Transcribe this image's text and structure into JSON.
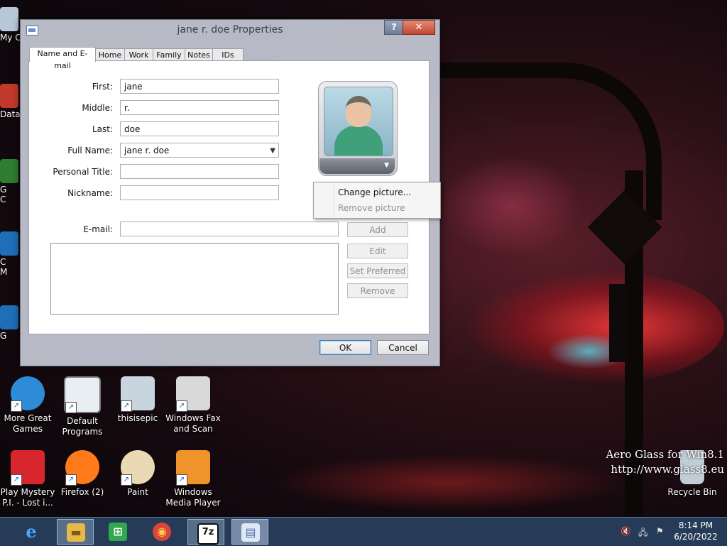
{
  "dialog": {
    "title": "jane r. doe Properties",
    "help_label": "?",
    "close_label": "✕",
    "tabs": [
      "Name and E-mail",
      "Home",
      "Work",
      "Family",
      "Notes",
      "IDs"
    ],
    "fields": {
      "first": {
        "label": "First:",
        "value": "jane"
      },
      "middle": {
        "label": "Middle:",
        "value": "r."
      },
      "last": {
        "label": "Last:",
        "value": "doe"
      },
      "full_name": {
        "label": "Full Name:",
        "value": "jane r. doe"
      },
      "personal_title": {
        "label": "Personal Title:",
        "value": ""
      },
      "nickname": {
        "label": "Nickname:",
        "value": ""
      },
      "email": {
        "label": "E-mail:",
        "value": ""
      }
    },
    "email_buttons": {
      "add": "Add",
      "edit": "Edit",
      "set_preferred": "Set Preferred",
      "remove": "Remove"
    },
    "ok_label": "OK",
    "cancel_label": "Cancel",
    "picture_menu": {
      "change": "Change picture...",
      "remove": "Remove picture"
    }
  },
  "desktop": {
    "icons": [
      {
        "label": "More Great Games",
        "icon": "games-icon",
        "color": "#2e8bd8"
      },
      {
        "label": "Default Programs",
        "icon": "default-programs-icon",
        "color": "#e8eef2"
      },
      {
        "label": "thisisepic",
        "icon": "picture-shortcut-icon",
        "color": "#c8d4de"
      },
      {
        "label": "Windows Fax and Scan",
        "icon": "fax-icon",
        "color": "#d9d9d9"
      },
      {
        "label": "Play Mystery P.I. - Lost i...",
        "icon": "mystery-pi-icon",
        "color": "#d8262e"
      },
      {
        "label": "Firefox (2)",
        "icon": "firefox-icon",
        "color": "#ff7a1a"
      },
      {
        "label": "Paint",
        "icon": "paint-icon",
        "color": "#e9d9b5"
      },
      {
        "label": "Windows Media Player",
        "icon": "media-player-icon",
        "color": "#f0932b"
      },
      {
        "label": "Recycle Bin",
        "icon": "recycle-bin-icon",
        "color": "#c0ccd6"
      }
    ],
    "partial_labels": [
      "My C",
      "Data",
      "G",
      "C",
      "C",
      "M",
      "G"
    ],
    "watermark_line1": "Aero Glass for Win8.1",
    "watermark_line2": "http://www.glass8.eu"
  },
  "taskbar": {
    "apps": [
      {
        "icon": "internet-explorer-icon",
        "glyph": "e",
        "color": "#1e90ff"
      },
      {
        "icon": "file-explorer-icon",
        "glyph": "▬",
        "color": "#e6b84a"
      },
      {
        "icon": "store-icon",
        "glyph": "⊞",
        "color": "#2fa84f"
      },
      {
        "icon": "chrome-icon",
        "glyph": "◉",
        "color": "#d9453b"
      },
      {
        "icon": "7zip-icon",
        "glyph": "7z",
        "color": "#222222"
      },
      {
        "icon": "contacts-icon",
        "glyph": "▤",
        "color": "#6b8fc9"
      }
    ],
    "time": "8:14 PM",
    "date": "6/20/2022"
  }
}
